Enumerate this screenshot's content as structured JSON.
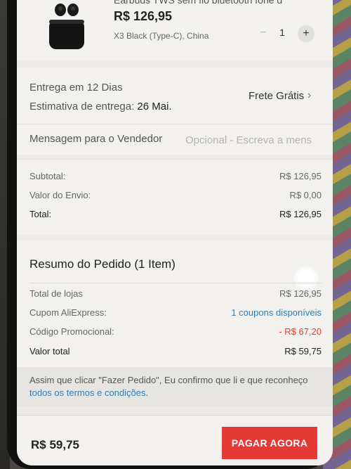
{
  "product": {
    "title_cut": "Earbuds TWS sem fio bluetooth fone d",
    "price": "R$ 126,95",
    "variant": "X3 Black (Type-C), China",
    "qty_minus": "−",
    "quantity": "1",
    "qty_plus": "+"
  },
  "delivery": {
    "days": "Entrega em 12 Dias",
    "estimate_label": "Estimativa de entrega: ",
    "estimate_date": "26 Mai.",
    "shipping": "Frete Grátis",
    "chevron": "›"
  },
  "message": {
    "label": "Mensagem para o Vendedor",
    "placeholder": "Opcional - Escreva a mens"
  },
  "totals": {
    "subtotal_label": "Subtotal:",
    "subtotal_value": "R$ 126,95",
    "shipping_label": "Valor do Envio:",
    "shipping_value": "R$ 0,00",
    "total_label": "Total:",
    "total_value": "R$ 126,95"
  },
  "summary": {
    "title": "Resumo do Pedido (1 Item)",
    "stores_label": "Total de lojas",
    "stores_value": "R$ 126,95",
    "coupon_label": "Cupom AliExpress:",
    "coupon_value": "1 coupons disponíveis",
    "promo_label": "Código Promocional:",
    "promo_value": "- R$ 67,20",
    "grand_label": "Valor total",
    "grand_value": "R$ 59,75"
  },
  "terms": {
    "text_before": "Assim que clicar \"Fazer Pedido\", Eu confirmo que li e que reconheço ",
    "link": "todos os termos e condições",
    "text_after": "."
  },
  "footer": {
    "total": "R$ 59,75",
    "pay_button": "PAGAR AGORA"
  },
  "colors": {
    "accent": "#e53935",
    "link": "#2f7fb6",
    "discount": "#d8413b"
  }
}
